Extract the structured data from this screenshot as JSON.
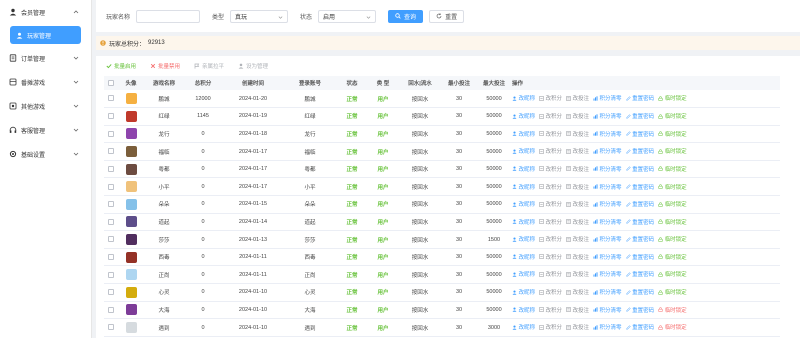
{
  "sidebar": {
    "items": [
      {
        "label": "会员管理",
        "icon": "user-icon",
        "expanded": true
      },
      {
        "label": "订单管理",
        "icon": "order-icon"
      },
      {
        "label": "番摊游戏",
        "icon": "game-icon"
      },
      {
        "label": "其他游戏",
        "icon": "other-game-icon"
      },
      {
        "label": "客服管理",
        "icon": "headset-icon"
      },
      {
        "label": "基础设置",
        "icon": "gear-icon"
      }
    ],
    "sub_item": {
      "label": "玩家管理",
      "icon": "user-icon"
    }
  },
  "search": {
    "name_label": "玩家名称",
    "name_value": "",
    "type_label": "类型",
    "type_value": "真玩",
    "status_label": "状态",
    "status_value": "启用",
    "query_label": "查询",
    "reset_label": "重置"
  },
  "summary": {
    "label": "玩家总积分：",
    "value": "92913"
  },
  "toolbar": {
    "enable_label": "批量启用",
    "disable_label": "批量禁用",
    "pin_label": "亲属拉平",
    "set_manager_label": "设为管理"
  },
  "table": {
    "headers": [
      "头像",
      "游戏名称",
      "总积分",
      "创建时间",
      "登录账号",
      "状态",
      "类 型",
      "回水|流水",
      "最小投注",
      "最大投注",
      "操作"
    ],
    "ops": [
      "改昵称",
      "改积分",
      "改投注",
      "积分清零",
      "重置密码",
      "临时锁定"
    ],
    "rows": [
      {
        "name": "鹏城",
        "points": "12000",
        "created": "2024-01-20",
        "account": "鹏城",
        "status": "正常",
        "type": "用户",
        "rebate": "按回水",
        "min": "30",
        "max": "50000",
        "lock_color": "green",
        "avatar_color": "#f5b041"
      },
      {
        "name": "红绿",
        "points": "1145",
        "created": "2024-01-19",
        "account": "红绿",
        "status": "正常",
        "type": "用户",
        "rebate": "按回水",
        "min": "30",
        "max": "50000",
        "lock_color": "green",
        "avatar_color": "#c0392b"
      },
      {
        "name": "龙行",
        "points": "0",
        "created": "2024-01-18",
        "account": "龙行",
        "status": "正常",
        "type": "用户",
        "rebate": "按回水",
        "min": "30",
        "max": "50000",
        "lock_color": "green",
        "avatar_color": "#8e44ad"
      },
      {
        "name": "福临",
        "points": "0",
        "created": "2024-01-17",
        "account": "福临",
        "status": "正常",
        "type": "用户",
        "rebate": "按回水",
        "min": "30",
        "max": "50000",
        "lock_color": "green",
        "avatar_color": "#7b5e3b"
      },
      {
        "name": "粤都",
        "points": "0",
        "created": "2024-01-17",
        "account": "粤都",
        "status": "正常",
        "type": "用户",
        "rebate": "按回水",
        "min": "30",
        "max": "50000",
        "lock_color": "green",
        "avatar_color": "#6d4c41"
      },
      {
        "name": "小平",
        "points": "0",
        "created": "2024-01-17",
        "account": "小平",
        "status": "正常",
        "type": "用户",
        "rebate": "按回水",
        "min": "30",
        "max": "50000",
        "lock_color": "green",
        "avatar_color": "#f0c27b"
      },
      {
        "name": "朵朵",
        "points": "0",
        "created": "2024-01-15",
        "account": "朵朵",
        "status": "正常",
        "type": "用户",
        "rebate": "按回水",
        "min": "30",
        "max": "50000",
        "lock_color": "green",
        "avatar_color": "#85c1e9"
      },
      {
        "name": "道起",
        "points": "0",
        "created": "2024-01-14",
        "account": "道起",
        "status": "正常",
        "type": "用户",
        "rebate": "按回水",
        "min": "30",
        "max": "50000",
        "lock_color": "green",
        "avatar_color": "#5d4e8a"
      },
      {
        "name": "莎莎",
        "points": "0",
        "created": "2024-01-13",
        "account": "莎莎",
        "status": "正常",
        "type": "用户",
        "rebate": "按回水",
        "min": "30",
        "max": "1500",
        "lock_color": "green",
        "avatar_color": "#512e5f"
      },
      {
        "name": "西毒",
        "points": "0",
        "created": "2024-01-11",
        "account": "西毒",
        "status": "正常",
        "type": "用户",
        "rebate": "按回水",
        "min": "30",
        "max": "50000",
        "lock_color": "green",
        "avatar_color": "#943126"
      },
      {
        "name": "正尚",
        "points": "0",
        "created": "2024-01-11",
        "account": "正尚",
        "status": "正常",
        "type": "用户",
        "rebate": "按回水",
        "min": "30",
        "max": "50000",
        "lock_color": "green",
        "avatar_color": "#aed6f1"
      },
      {
        "name": "心灵",
        "points": "0",
        "created": "2024-01-10",
        "account": "心灵",
        "status": "正常",
        "type": "用户",
        "rebate": "按回水",
        "min": "30",
        "max": "50000",
        "lock_color": "green",
        "avatar_color": "#d4ac0d"
      },
      {
        "name": "大海",
        "points": "0",
        "created": "2024-01-10",
        "account": "大海",
        "status": "正常",
        "type": "用户",
        "rebate": "按回水",
        "min": "30",
        "max": "50000",
        "lock_color": "red",
        "avatar_color": "#7d3c98"
      },
      {
        "name": "遇到",
        "points": "0",
        "created": "2024-01-10",
        "account": "遇到",
        "status": "正常",
        "type": "用户",
        "rebate": "按回水",
        "min": "30",
        "max": "3000",
        "lock_color": "red",
        "avatar_color": "#d6dbdf"
      }
    ]
  },
  "colors": {
    "primary": "#409eff",
    "success": "#67c23a",
    "danger": "#f56c6c",
    "warning_bg": "#fdf6ec"
  }
}
